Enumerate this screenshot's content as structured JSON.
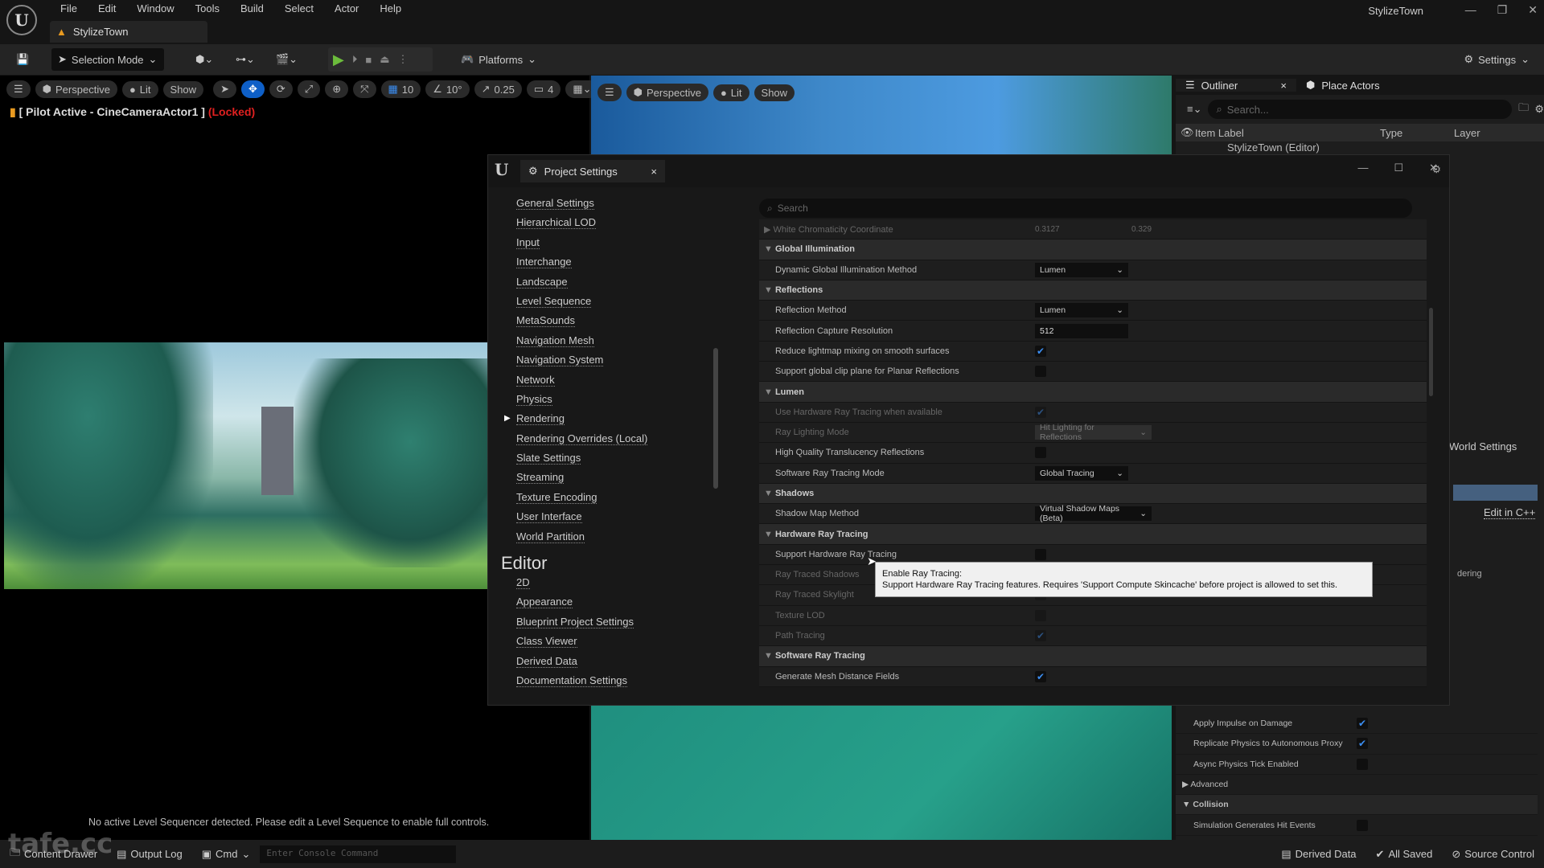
{
  "app": {
    "window_title": "StylizeTown",
    "doc_tab": "StylizeTown",
    "menu": [
      "File",
      "Edit",
      "Window",
      "Tools",
      "Build",
      "Select",
      "Actor",
      "Help"
    ],
    "window_buttons": [
      "minimize",
      "restore",
      "close"
    ]
  },
  "toolbar": {
    "selection_mode": "Selection Mode",
    "platforms": "Platforms",
    "settings": "Settings"
  },
  "viewport_left": {
    "perspective": "Perspective",
    "lit": "Lit",
    "show": "Show",
    "grid_snap": "10",
    "rot_snap": "10°",
    "scale_snap": "0.25",
    "cam_speed": "4",
    "pilot_label": "[ Pilot Active - CineCameraActor1 ]",
    "locked": "(Locked)",
    "sequencer_msg": "No active Level Sequencer detected. Please edit a Level Sequence to enable full controls."
  },
  "viewport_right": {
    "perspective": "Perspective",
    "lit": "Lit",
    "show": "Show"
  },
  "outliner": {
    "tab": "Outliner",
    "place_actors": "Place Actors",
    "search_placeholder": "Search...",
    "columns": [
      "Item Label",
      "Type",
      "Layer"
    ],
    "first_item": "StylizeTown (Editor)"
  },
  "details": {
    "world_settings": "World Settings",
    "edit_cpp": "Edit in C++",
    "partial": "dering",
    "rows": [
      {
        "label": "Apply Impulse on Damage",
        "checked": true
      },
      {
        "label": "Replicate Physics to Autonomous Proxy",
        "checked": true
      },
      {
        "label": "Async Physics Tick Enabled",
        "checked": false
      },
      {
        "label": "Advanced",
        "category": true,
        "collapsed": true
      },
      {
        "label": "Collision",
        "category": true
      },
      {
        "label": "Simulation Generates Hit Events",
        "checked": false
      }
    ]
  },
  "project_settings": {
    "title": "Project Settings",
    "search_placeholder": "Search",
    "nav": [
      "General Settings",
      "Hierarchical LOD",
      "Input",
      "Interchange",
      "Landscape",
      "Level Sequence",
      "MetaSounds",
      "Navigation Mesh",
      "Navigation System",
      "Network",
      "Physics",
      "Rendering",
      "Rendering Overrides (Local)",
      "Slate Settings",
      "Streaming",
      "Texture Encoding",
      "User Interface",
      "World Partition"
    ],
    "nav_selected": "Rendering",
    "editor_heading": "Editor",
    "editor_nav": [
      "2D",
      "Appearance",
      "Blueprint Project Settings",
      "Class Viewer",
      "Derived Data",
      "Documentation Settings"
    ],
    "rows": [
      {
        "label": "White Chromaticity Coordinate",
        "type": "pair",
        "values": [
          "0.3127",
          "0.329"
        ],
        "dim": true
      },
      {
        "label": "Global Illumination",
        "type": "category"
      },
      {
        "label": "Dynamic Global Illumination Method",
        "type": "dropdown",
        "value": "Lumen"
      },
      {
        "label": "Reflections",
        "type": "category"
      },
      {
        "label": "Reflection Method",
        "type": "dropdown",
        "value": "Lumen"
      },
      {
        "label": "Reflection Capture Resolution",
        "type": "number",
        "value": "512"
      },
      {
        "label": "Reduce lightmap mixing on smooth surfaces",
        "type": "checkbox",
        "checked": true
      },
      {
        "label": "Support global clip plane for Planar Reflections",
        "type": "checkbox",
        "checked": false
      },
      {
        "label": "Lumen",
        "type": "category"
      },
      {
        "label": "Use Hardware Ray Tracing when available",
        "type": "checkbox",
        "checked": true,
        "dim": true
      },
      {
        "label": "Ray Lighting Mode",
        "type": "dropdown",
        "value": "Hit Lighting for Reflections",
        "dim": true
      },
      {
        "label": "High Quality Translucency Reflections",
        "type": "checkbox",
        "checked": false
      },
      {
        "label": "Software Ray Tracing Mode",
        "type": "dropdown",
        "value": "Global Tracing"
      },
      {
        "label": "Shadows",
        "type": "category"
      },
      {
        "label": "Shadow Map Method",
        "type": "dropdown",
        "value": "Virtual Shadow Maps (Beta)"
      },
      {
        "label": "Hardware Ray Tracing",
        "type": "category"
      },
      {
        "label": "Support Hardware Ray Tracing",
        "type": "checkbox",
        "checked": false
      },
      {
        "label": "Ray Traced Shadows",
        "type": "checkbox",
        "checked": false,
        "dim": true
      },
      {
        "label": "Ray Traced Skylight",
        "type": "checkbox",
        "checked": false,
        "dim": true
      },
      {
        "label": "Texture LOD",
        "type": "checkbox",
        "checked": false,
        "dim": true
      },
      {
        "label": "Path Tracing",
        "type": "checkbox",
        "checked": true,
        "dim": true
      },
      {
        "label": "Software Ray Tracing",
        "type": "category"
      },
      {
        "label": "Generate Mesh Distance Fields",
        "type": "checkbox",
        "checked": true
      }
    ],
    "tooltip": {
      "title": "Enable Ray Tracing:",
      "body": "Support Hardware Ray Tracing features.  Requires 'Support Compute Skincache' before project is allowed to set this."
    }
  },
  "statusbar": {
    "content_drawer": "Content Drawer",
    "output_log": "Output Log",
    "cmd": "Cmd",
    "console_placeholder": "Enter Console Command",
    "derived_data": "Derived Data",
    "all_saved": "All Saved",
    "source_control": "Source Control"
  },
  "watermark": "tafe.cc",
  "colors": {
    "accent": "#0e5fc7",
    "locked": "#e02020",
    "play": "#6cbc3c",
    "checkbox": "#3b8df0"
  }
}
